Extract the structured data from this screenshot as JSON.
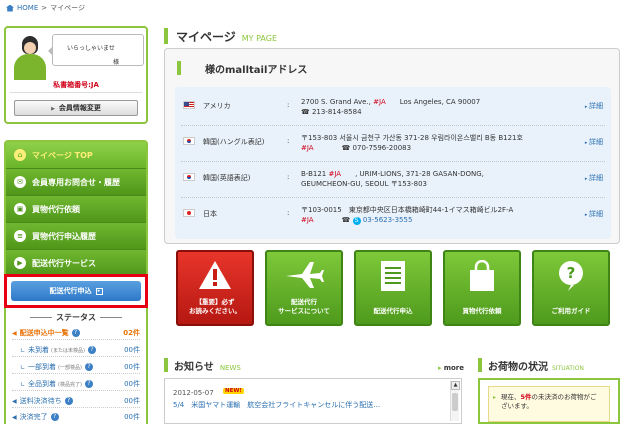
{
  "breadcrumb": {
    "home": "HOME",
    "sep": ">",
    "current": "マイページ"
  },
  "user": {
    "greeting": "いらっしゃいませ",
    "honorific": "様",
    "mailbox": "私書箱番号:JA",
    "member_btn": "会員情報変更"
  },
  "menu": {
    "items": [
      {
        "label": "マイページ TOP",
        "icon": "home-icon"
      },
      {
        "label": "会員専用お問合せ・履歴",
        "icon": "mail-icon"
      },
      {
        "label": "買物代行依頼",
        "icon": "cart-icon"
      },
      {
        "label": "買物代行申込履歴",
        "icon": "list-icon"
      },
      {
        "label": "配送代行サービス",
        "icon": "truck-icon"
      }
    ],
    "ship_apply": "配送代行申込"
  },
  "status": {
    "title": "ステータス",
    "rows": [
      {
        "label": "配送申込中一覧",
        "sub": "",
        "count": "02件"
      },
      {
        "label": "未到着",
        "sub": "(または未検品)",
        "count": "00件"
      },
      {
        "label": "一部到着",
        "sub": "(一部検品)",
        "count": "00件"
      },
      {
        "label": "全品到着",
        "sub": "(検品完了)",
        "count": "00件"
      },
      {
        "label": "送料決済待ち",
        "sub": "",
        "count": "00件"
      },
      {
        "label": "決済完了",
        "sub": "",
        "count": "00件"
      }
    ]
  },
  "page": {
    "title": "マイページ",
    "title_en": "MY PAGE"
  },
  "address": {
    "title": "様のmalltailアドレス",
    "detail": "詳細",
    "rows": [
      {
        "country": "アメリカ",
        "flag": "us",
        "line1a": "2700 S. Grand Ave.,",
        "line1b": "#JA",
        "line1c": "Los Angeles, CA 90007",
        "line2": "☎ 213-814-8584"
      },
      {
        "country": "韓国(ハングル表記)",
        "flag": "kr",
        "line1a": "〒153-803 서울시 금천구 가산동 371-28 우림라이온스밸리 B동 B121호",
        "line2a": "#JA",
        "line2b": "☎ 070-7596-20083"
      },
      {
        "country": "韓国(英語表記)",
        "flag": "kr",
        "line1a": "B-B121",
        "line1b": "#JA",
        "line1c": ", URIM-LIONS, 371-28 GASAN-DONG,",
        "line2": "GEUMCHEON-GU, SEOUL 〒153-803"
      },
      {
        "country": "日本",
        "flag": "jp",
        "line1a": "〒103-0015　東京都中央区日本橋箱崎町44-1イマス箱崎ビル2F-A",
        "line2a": "#JA",
        "line2b": "☎",
        "line2c": "03-5623-3555"
      }
    ]
  },
  "tiles": [
    {
      "label1": "【重要】必ず",
      "label2": "お読みください。",
      "icon": "warning-icon",
      "color": "#d8261c"
    },
    {
      "label1": "配送代行",
      "label2": "サービスについて",
      "icon": "airplane-icon",
      "color": "#62b12a"
    },
    {
      "label1": "",
      "label2": "配送代行申込",
      "icon": "document-icon",
      "color": "#62b12a"
    },
    {
      "label1": "",
      "label2": "買物代行依頼",
      "icon": "shopping-bag-icon",
      "color": "#62b12a"
    },
    {
      "label1": "",
      "label2": "ご利用ガイド",
      "icon": "help-icon",
      "color": "#62b12a"
    }
  ],
  "news": {
    "title": "お知らせ",
    "title_en": "NEWS",
    "more": "more",
    "date": "2012-05-07",
    "badge": "NEW!",
    "item": "5/4　米国ヤマト運輸　航空会社フライトキャンセルに伴う配送…"
  },
  "package": {
    "title": "お荷物の状況",
    "title_en": "SITUATION",
    "text_pre": "現在、",
    "count": "5件",
    "text_post": "の未決済のお荷物がございます。"
  },
  "colors": {
    "accent": "#8cc63f",
    "alert": "#e60012",
    "link": "#2a6fb0"
  }
}
